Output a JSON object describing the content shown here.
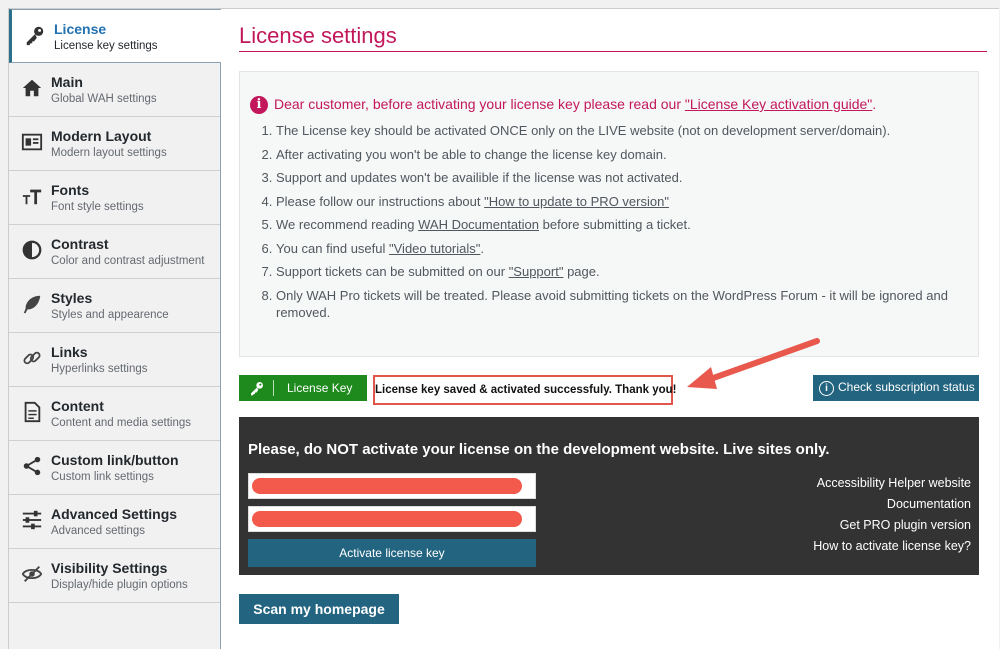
{
  "sidebar": {
    "items": [
      {
        "label": "License",
        "sub": "License key settings",
        "icon": "key-icon"
      },
      {
        "label": "Main",
        "sub": "Global WAH settings",
        "icon": "home-icon"
      },
      {
        "label": "Modern Layout",
        "sub": "Modern layout settings",
        "icon": "layout-icon"
      },
      {
        "label": "Fonts",
        "sub": "Font style settings",
        "icon": "font-size-icon"
      },
      {
        "label": "Contrast",
        "sub": "Color and contrast adjustment",
        "icon": "contrast-icon"
      },
      {
        "label": "Styles",
        "sub": "Styles and appearence",
        "icon": "feather-icon"
      },
      {
        "label": "Links",
        "sub": "Hyperlinks settings",
        "icon": "link-icon"
      },
      {
        "label": "Content",
        "sub": "Content and media settings",
        "icon": "document-icon"
      },
      {
        "label": "Custom link/button",
        "sub": "Custom link settings",
        "icon": "share-icon"
      },
      {
        "label": "Advanced Settings",
        "sub": "Advanced settings",
        "icon": "sliders-icon"
      },
      {
        "label": "Visibility Settings",
        "sub": "Display/hide plugin options",
        "icon": "eye-slash-icon"
      }
    ]
  },
  "page": {
    "title": "License settings"
  },
  "notice": {
    "head_prefix": "Dear customer, before activating your license key please read our ",
    "head_link": "\"License Key activation guide\"",
    "head_suffix": ".",
    "items": [
      {
        "pre": "The License key should be activated ONCE only on the LIVE website (not on development server/domain).",
        "link": "",
        "post": ""
      },
      {
        "pre": "After activating you won't be able to change the license key domain.",
        "link": "",
        "post": ""
      },
      {
        "pre": "Support and updates won't be availible if the license was not activated.",
        "link": "",
        "post": ""
      },
      {
        "pre": "Please follow our instructions about ",
        "link": "\"How to update to PRO version\"",
        "post": ""
      },
      {
        "pre": "We recommend reading ",
        "link": "WAH Documentation",
        "post": " before submitting a ticket."
      },
      {
        "pre": "You can find useful ",
        "link": "\"Video tutorials\"",
        "post": "."
      },
      {
        "pre": "Support tickets can be submitted on our ",
        "link": "\"Support\"",
        "post": " page."
      },
      {
        "pre": "Only WAH Pro tickets will be treated. Please avoid submitting tickets on the WordPress Forum - it will be ignored and removed.",
        "link": "",
        "post": ""
      }
    ]
  },
  "actions": {
    "license_key_label": "License Key",
    "success_message": "License key saved & activated successfuly. Thank you!",
    "check_subscription_label": "Check subscription status"
  },
  "activation": {
    "warning": "Please, do NOT activate your license on the development website. Live sites only.",
    "activate_label": "Activate license key",
    "links": [
      "Accessibility Helper website",
      "Documentation",
      "Get PRO plugin version",
      "How to activate license key?"
    ]
  },
  "scan": {
    "label": "Scan my homepage"
  },
  "colors": {
    "accent": "#c2185b",
    "primary": "#236580",
    "success": "#1e8a1e",
    "highlight": "#e0564c"
  }
}
